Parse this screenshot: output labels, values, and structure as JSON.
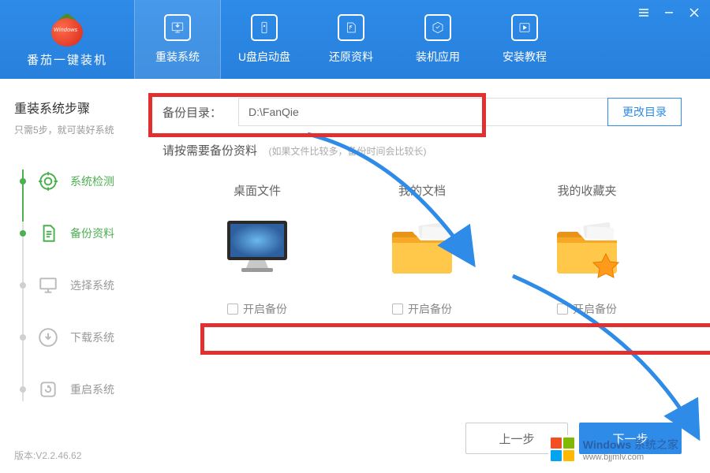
{
  "app": {
    "name": "番茄一键装机",
    "logo_text": "Windows"
  },
  "nav": {
    "items": [
      {
        "label": "重装系统"
      },
      {
        "label": "U盘启动盘"
      },
      {
        "label": "还原资料"
      },
      {
        "label": "装机应用"
      },
      {
        "label": "安装教程"
      }
    ]
  },
  "sidebar": {
    "title": "重装系统步骤",
    "subtitle": "只需5步，就可装好系统",
    "steps": [
      {
        "label": "系统检测"
      },
      {
        "label": "备份资料"
      },
      {
        "label": "选择系统"
      },
      {
        "label": "下载系统"
      },
      {
        "label": "重启系统"
      }
    ],
    "version": "版本:V2.2.46.62"
  },
  "main": {
    "path_label": "备份目录：",
    "path_value": "D:\\FanQie",
    "path_button": "更改目录",
    "section_title": "请按需要备份资料",
    "section_hint": "(如果文件比较多，备份时间会比较长)",
    "cards": [
      {
        "title": "桌面文件",
        "check": "开启备份"
      },
      {
        "title": "我的文档",
        "check": "开启备份"
      },
      {
        "title": "我的收藏夹",
        "check": "开启备份"
      }
    ],
    "prev": "上一步",
    "next": "下一步"
  },
  "watermark": {
    "brand": "Windows",
    "suffix": " 系统之家",
    "url": "www.bjjmlv.com"
  }
}
